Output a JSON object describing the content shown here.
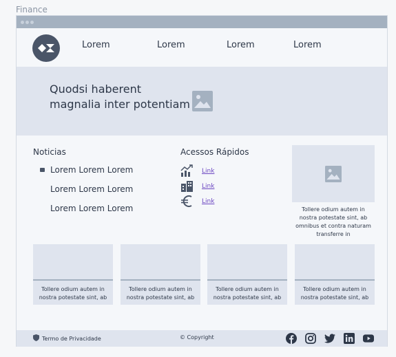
{
  "page_label": "Finance",
  "nav": {
    "links": [
      "Lorem",
      "Lorem",
      "Lorem",
      "Lorem"
    ]
  },
  "hero": {
    "title": "Quodsi haberent magnalia inter potentiam"
  },
  "news": {
    "title": "Noticias",
    "items": [
      "Lorem Lorem Lorem",
      "Lorem Lorem Lorem",
      "Lorem Lorem Lorem"
    ]
  },
  "quick_access": {
    "title": "Acessos Rápidos",
    "links": [
      {
        "icon": "chart-growth-icon",
        "label": "Link"
      },
      {
        "icon": "bank-building-icon",
        "label": "Link"
      },
      {
        "icon": "euro-icon",
        "label": "Link"
      }
    ]
  },
  "side_card": {
    "text": "Tollere odium autem in nostra potestate sint, ab omnibus et contra naturam transferre in"
  },
  "cards": [
    {
      "text": "Tollere odium autem in nostra potestate sint, ab"
    },
    {
      "text": "Tollere odium autem in nostra potestate sint, ab"
    },
    {
      "text": "Tollere odium autem in nostra potestate sint, ab"
    },
    {
      "text": "Tollere odium autem in nostra potestate sint, ab"
    }
  ],
  "footer": {
    "privacy": "Termo de Privacidade",
    "copyright": "© Copyright",
    "social": [
      "facebook-icon",
      "instagram-icon",
      "twitter-icon",
      "linkedin-icon",
      "youtube-icon"
    ]
  },
  "colors": {
    "accent_dark": "#4a5568",
    "panel": "#dfe4ee",
    "link": "#6b46c1",
    "titlebar": "#a4b1c0"
  }
}
